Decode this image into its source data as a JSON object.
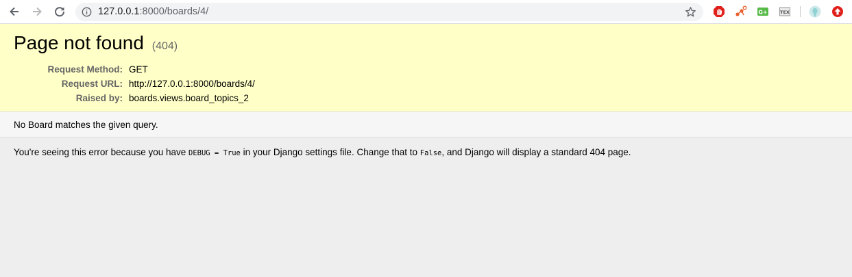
{
  "browser": {
    "url_host": "127.0.0.1",
    "url_rest": ":8000/boards/4/",
    "icons": {
      "back": "arrow-left-icon",
      "forward": "arrow-right-icon",
      "reload": "reload-icon",
      "site_info": "info-icon",
      "bookmark": "star-icon"
    },
    "extensions": [
      {
        "name": "adblock-extension-icon",
        "color": "#e0201b"
      },
      {
        "name": "network-extension-icon",
        "color": "#e8602c"
      },
      {
        "name": "google-plus-extension-icon",
        "color": "#57b947",
        "text": "G+"
      },
      {
        "name": "tex-extension-icon",
        "color": "#777777",
        "text": "TEX"
      },
      {
        "name": "profile-avatar-icon",
        "color": "#a8d8d8"
      },
      {
        "name": "update-extension-icon",
        "color": "#e0201b"
      }
    ]
  },
  "page": {
    "title": "Page not found",
    "code": "(404)",
    "meta": [
      {
        "label": "Request Method:",
        "value": "GET"
      },
      {
        "label": "Request URL:",
        "value": "http://127.0.0.1:8000/boards/4/"
      },
      {
        "label": "Raised by:",
        "value": "boards.views.board_topics_2"
      }
    ],
    "info": "No Board matches the given query.",
    "explanation": {
      "part1": "You're seeing this error because you have ",
      "code1": "DEBUG = True",
      "part2": " in your Django settings file. Change that to ",
      "code2": "False",
      "part3": ", and Django will display a standard 404 page."
    }
  },
  "colors": {
    "summary_bg": "#ffffc8",
    "info_bg": "#f6f6f6",
    "body_bg": "#eeeeee"
  }
}
